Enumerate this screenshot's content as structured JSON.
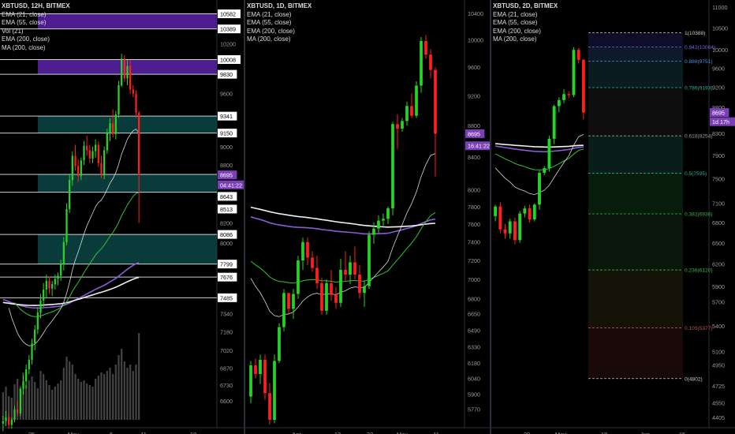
{
  "colors": {
    "background": "#000000",
    "candle_up": "#26d326",
    "candle_down": "#ff1f1f",
    "ema21": "#d7d7d7",
    "ema55": "#33c233",
    "ema200": "#8a5cd6",
    "ma200": "#f0f0f0",
    "zone_purple": "#5b22a8",
    "zone_teal": "#0d4a4a",
    "current_price_bg": "#7b3fb5"
  },
  "chart_data": [
    {
      "id": "pane1",
      "type": "candlestick",
      "title": "XBTUSD, 12H, BITMEX",
      "legend": [
        "XBTUSD, 12H, BITMEX",
        "EMA (21, close)",
        "EMA (55, close)",
        "Vol (21)",
        "EMA (200, close)",
        "MA (200, close)"
      ],
      "y_axis": {
        "scale": "log",
        "ticks": [
          10200,
          9600,
          9000,
          8800,
          8200,
          8000,
          7340,
          7180,
          7020,
          6870,
          6730,
          6600
        ]
      },
      "x_axis": {
        "ticks": [
          "25",
          "May",
          "6",
          "11",
          "18"
        ]
      },
      "price_labels": [
        {
          "text": "10582",
          "value": 10582,
          "style": "white"
        },
        {
          "text": "10389",
          "value": 10389,
          "style": "white"
        },
        {
          "text": "10008",
          "value": 10008,
          "style": "white"
        },
        {
          "text": "9830",
          "value": 9830,
          "style": "white"
        },
        {
          "text": "9341",
          "value": 9341,
          "style": "white"
        },
        {
          "text": "9150",
          "value": 9150,
          "style": "white"
        },
        {
          "text": "8695",
          "value": 8695,
          "style": "purple"
        },
        {
          "text": "04:41:22",
          "value": 8590,
          "style": "purple"
        },
        {
          "text": "8643",
          "value": 8470,
          "style": "white"
        },
        {
          "text": "8513",
          "value": 8340,
          "style": "white"
        },
        {
          "text": "8086",
          "value": 8086,
          "style": "white"
        },
        {
          "text": "7799",
          "value": 7799,
          "style": "white"
        },
        {
          "text": "7676",
          "value": 7676,
          "style": "white"
        },
        {
          "text": "7485",
          "value": 7485,
          "style": "white"
        }
      ],
      "horizontal_lines": [
        10582,
        10389,
        10008,
        9830,
        9341,
        9150,
        8700,
        8513,
        8086,
        7799,
        7676,
        7485
      ],
      "zones": [
        {
          "from": 10389,
          "to": 10582,
          "color": "purple"
        },
        {
          "from": 9830,
          "to": 10008,
          "color": "purple"
        },
        {
          "from": 9150,
          "to": 9341,
          "color": "teal"
        },
        {
          "from": 8513,
          "to": 8700,
          "color": "teal"
        },
        {
          "from": 7799,
          "to": 8086,
          "color": "teal"
        }
      ],
      "candles": [
        [
          6420,
          6480,
          6360,
          6440
        ],
        [
          6440,
          6520,
          6400,
          6470
        ],
        [
          6470,
          6500,
          6380,
          6410
        ],
        [
          6410,
          6470,
          6380,
          6450
        ],
        [
          6450,
          6560,
          6430,
          6530
        ],
        [
          6530,
          6600,
          6480,
          6500
        ],
        [
          6500,
          6720,
          6480,
          6700
        ],
        [
          6700,
          6810,
          6650,
          6760
        ],
        [
          6760,
          6900,
          6700,
          6860
        ],
        [
          6860,
          6980,
          6820,
          6940
        ],
        [
          6940,
          7120,
          6900,
          7080
        ],
        [
          7080,
          7240,
          7020,
          7200
        ],
        [
          7200,
          7400,
          7160,
          7350
        ],
        [
          7350,
          7520,
          7300,
          7460
        ],
        [
          7460,
          7620,
          7400,
          7560
        ],
        [
          7560,
          7700,
          7480,
          7640
        ],
        [
          7640,
          7680,
          7520,
          7570
        ],
        [
          7570,
          7640,
          7500,
          7610
        ],
        [
          7610,
          7700,
          7560,
          7660
        ],
        [
          7660,
          7720,
          7600,
          7690
        ],
        [
          7690,
          7840,
          7640,
          7800
        ],
        [
          7800,
          8060,
          7740,
          8010
        ],
        [
          8010,
          8400,
          7980,
          8340
        ],
        [
          8340,
          8700,
          8300,
          8640
        ],
        [
          8640,
          8950,
          8580,
          8900
        ],
        [
          8900,
          9020,
          8740,
          8790
        ],
        [
          8790,
          8860,
          8620,
          8680
        ],
        [
          8680,
          8880,
          8640,
          8850
        ],
        [
          8850,
          9060,
          8800,
          9010
        ],
        [
          9010,
          9120,
          8900,
          8960
        ],
        [
          8960,
          9020,
          8820,
          8870
        ],
        [
          8870,
          9000,
          8820,
          8950
        ],
        [
          8950,
          9080,
          8880,
          9020
        ],
        [
          9020,
          9060,
          8780,
          8820
        ],
        [
          8820,
          8900,
          8660,
          8690
        ],
        [
          8690,
          9000,
          8650,
          8960
        ],
        [
          8960,
          9200,
          8920,
          9150
        ],
        [
          9150,
          9320,
          9060,
          9260
        ],
        [
          9260,
          9420,
          9100,
          9140
        ],
        [
          9140,
          9400,
          9080,
          9360
        ],
        [
          9360,
          9750,
          9320,
          9700
        ],
        [
          9700,
          10080,
          9680,
          10020
        ],
        [
          10020,
          10060,
          9740,
          9780
        ],
        [
          9780,
          10000,
          9700,
          9930
        ],
        [
          9930,
          10000,
          9600,
          9650
        ],
        [
          9650,
          9700,
          9560,
          9600
        ],
        [
          9600,
          9640,
          9320,
          9380
        ],
        [
          9380,
          9400,
          8200,
          8695
        ]
      ],
      "volume": [
        35,
        42,
        30,
        28,
        45,
        52,
        38,
        60,
        44,
        50,
        55,
        48,
        40,
        62,
        58,
        50,
        44,
        38,
        42,
        46,
        50,
        66,
        80,
        74,
        70,
        58,
        52,
        48,
        50,
        46,
        44,
        42,
        52,
        56,
        60,
        58,
        62,
        66,
        58,
        70,
        82,
        90,
        74,
        66,
        70,
        62,
        70,
        110
      ]
    },
    {
      "id": "pane2",
      "type": "candlestick",
      "title": "XBTUSD, 1D, BITMEX",
      "legend": [
        "XBTUSD, 1D, BITMEX",
        "EMA (21, close)",
        "EMA (55, close)",
        "EMA (200, close)",
        "MA (200, close)"
      ],
      "y_axis": {
        "scale": "log",
        "ticks": [
          10400,
          10000,
          9600,
          9200,
          8800,
          8400,
          8000,
          7800,
          7600,
          7400,
          7200,
          7000,
          6800,
          6650,
          6490,
          6330,
          6180,
          6040,
          5900,
          5770
        ]
      },
      "x_axis": {
        "ticks": [
          "Apr",
          "13",
          "22",
          "May",
          "11"
        ]
      },
      "price_labels": [
        {
          "text": "8695",
          "value": 8695,
          "style": "purple"
        },
        {
          "text": "16:41:22",
          "value": 8540,
          "style": "purple"
        }
      ],
      "candles": [
        [
          5880,
          6200,
          5820,
          6160
        ],
        [
          6160,
          6220,
          6040,
          6080
        ],
        [
          6080,
          6260,
          5990,
          6210
        ],
        [
          6210,
          6260,
          5850,
          5910
        ],
        [
          5910,
          6000,
          5640,
          5680
        ],
        [
          5680,
          6260,
          5650,
          6200
        ],
        [
          6200,
          6560,
          6180,
          6520
        ],
        [
          6520,
          6900,
          6480,
          6860
        ],
        [
          6860,
          6820,
          6640,
          6700
        ],
        [
          6700,
          6900,
          6600,
          6850
        ],
        [
          6850,
          7250,
          6800,
          7200
        ],
        [
          7200,
          7450,
          7100,
          7400
        ],
        [
          7400,
          7450,
          7150,
          7230
        ],
        [
          7230,
          7300,
          7080,
          7120
        ],
        [
          7120,
          7250,
          6900,
          6960
        ],
        [
          6960,
          7020,
          6640,
          6680
        ],
        [
          6680,
          7000,
          6640,
          6960
        ],
        [
          6960,
          7100,
          6780,
          6840
        ],
        [
          6840,
          6920,
          6700,
          6760
        ],
        [
          6760,
          7220,
          6720,
          7100
        ],
        [
          7100,
          7300,
          6980,
          7050
        ],
        [
          7050,
          7250,
          6950,
          7180
        ],
        [
          7180,
          7350,
          7000,
          7050
        ],
        [
          7050,
          7150,
          6800,
          6860
        ],
        [
          6860,
          6990,
          6720,
          6930
        ],
        [
          6930,
          7520,
          6900,
          7480
        ],
        [
          7480,
          7620,
          7380,
          7550
        ],
        [
          7550,
          7700,
          7500,
          7640
        ],
        [
          7640,
          7720,
          7580,
          7660
        ],
        [
          7660,
          7800,
          7600,
          7780
        ],
        [
          7780,
          8850,
          7700,
          8820
        ],
        [
          8820,
          8950,
          8500,
          8760
        ],
        [
          8760,
          8900,
          8720,
          8860
        ],
        [
          8860,
          9120,
          8800,
          9060
        ],
        [
          9060,
          9230,
          8900,
          8930
        ],
        [
          8930,
          9400,
          8900,
          9340
        ],
        [
          9340,
          10040,
          9240,
          9980
        ],
        [
          9980,
          10070,
          9720,
          9780
        ],
        [
          9780,
          9860,
          9440,
          9560
        ],
        [
          9560,
          9600,
          8160,
          8695
        ]
      ]
    },
    {
      "id": "pane3",
      "type": "candlestick",
      "title": "XBTUSD, 2D, BITMEX",
      "legend": [
        "XBTUSD, 2D, BITMEX",
        "EMA (21, close)",
        "EMA (55, close)",
        "EMA (200, close)",
        "MA (200, close)"
      ],
      "y_axis": {
        "scale": "log",
        "ticks": [
          11000,
          10500,
          10000,
          9600,
          9200,
          8800,
          8300,
          7900,
          7500,
          7100,
          6800,
          6500,
          6200,
          5900,
          5700,
          5400,
          5100,
          4950,
          4725,
          4550,
          4405
        ]
      },
      "x_axis": {
        "ticks": [
          "20",
          "May",
          "18",
          "Jun",
          "15"
        ]
      },
      "price_labels": [
        {
          "text": "8695",
          "value": 8695,
          "style": "purple"
        },
        {
          "text": "1d 17h",
          "value": 8520,
          "style": "purple"
        }
      ],
      "fibonacci": {
        "high": 10388,
        "low": 4802,
        "levels": [
          {
            "label": "1(10388)",
            "value": 10388,
            "color": "#c8c8c8"
          },
          {
            "label": "0.942(10064)",
            "value": 10064,
            "color": "#6a6ad8"
          },
          {
            "label": "0.886(9751)",
            "value": 9751,
            "color": "#4a8cd8"
          },
          {
            "label": "0.786(9193)",
            "value": 9193,
            "color": "#2ab0a8"
          },
          {
            "label": "0.618(8254)",
            "value": 8254,
            "color": "#9a9a9a"
          },
          {
            "label": "0.5(7595)",
            "value": 7595,
            "color": "#2aa898"
          },
          {
            "label": "0.382(6936)",
            "value": 6936,
            "color": "#3cb44a"
          },
          {
            "label": "0.236(6120)",
            "value": 6120,
            "color": "#3cb44a"
          },
          {
            "label": "0.105(5377)",
            "value": 5377,
            "color": "#c0504d"
          },
          {
            "label": "0(4802)",
            "value": 4802,
            "color": "#c8c8c8"
          }
        ]
      },
      "candles": [
        [
          6900,
          7080,
          6820,
          7050
        ],
        [
          7050,
          7120,
          6640,
          6700
        ],
        [
          6700,
          6780,
          6560,
          6640
        ],
        [
          6640,
          6860,
          6560,
          6820
        ],
        [
          6820,
          6880,
          6480,
          6540
        ],
        [
          6540,
          6980,
          6500,
          6940
        ],
        [
          6940,
          7060,
          6880,
          7020
        ],
        [
          7020,
          7080,
          6800,
          6850
        ],
        [
          6850,
          7100,
          6820,
          7080
        ],
        [
          7080,
          7640,
          7000,
          7600
        ],
        [
          7600,
          7720,
          7560,
          7680
        ],
        [
          7680,
          8260,
          7620,
          8200
        ],
        [
          8200,
          8850,
          8100,
          8820
        ],
        [
          8820,
          9000,
          8700,
          8940
        ],
        [
          8940,
          9160,
          8880,
          9060
        ],
        [
          9060,
          9120,
          8980,
          9040
        ],
        [
          9040,
          10060,
          9000,
          10000
        ],
        [
          10000,
          10040,
          9700,
          9780
        ],
        [
          9780,
          9800,
          8560,
          8695
        ]
      ]
    }
  ]
}
